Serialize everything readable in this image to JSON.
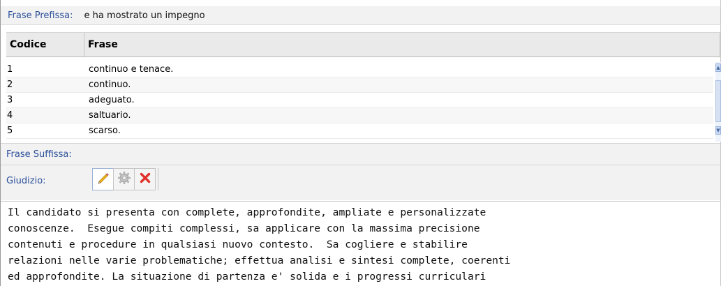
{
  "prefix": {
    "label": "Frase Prefissa:",
    "value": "e ha mostrato un impegno"
  },
  "grid": {
    "columns": {
      "code": "Codice",
      "frase": "Frase"
    },
    "rows": [
      {
        "code": "1",
        "frase": "continuo e tenace."
      },
      {
        "code": "2",
        "frase": "continuo."
      },
      {
        "code": "3",
        "frase": "adeguato."
      },
      {
        "code": "4",
        "frase": "saltuario."
      },
      {
        "code": "5",
        "frase": "scarso."
      }
    ]
  },
  "suffix": {
    "label": "Frase Suffissa:"
  },
  "giudizio": {
    "label": "Giudizio:",
    "toolbar": {
      "edit_icon": "pencil-icon",
      "settings_icon": "gear-icon",
      "delete_icon": "red-x-icon"
    }
  },
  "editor": {
    "lines": [
      "Il candidato si presenta con complete, approfondite, ampliate e personalizzate",
      "conoscenze.  Esegue compiti complessi, sa applicare con la massima precisione",
      "contenuti e procedure in qualsiasi nuovo contesto.  Sa cogliere e stabilire",
      "relazioni nelle varie problematiche; effettua analisi e sintesi complete, coerenti",
      "ed approfondite. La situazione di partenza e' solida e i progressi curriculari"
    ]
  }
}
